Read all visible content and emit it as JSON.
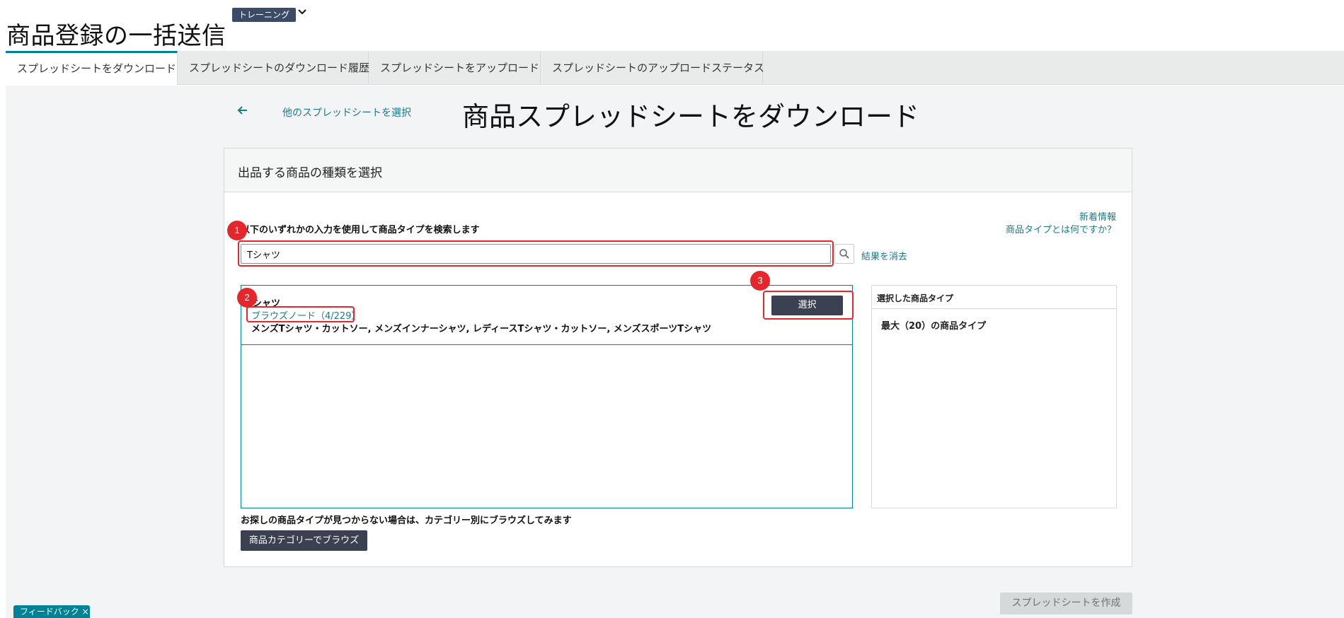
{
  "header": {
    "badge": "トレーニング",
    "title": "商品登録の一括送信"
  },
  "tabs": [
    "スプレッドシートをダウンロード",
    "スプレッドシートのダウンロード履歴",
    "スプレッドシートをアップロード",
    "スプレッドシートのアップロードステータス"
  ],
  "nav": {
    "back_link": "他のスプレッドシートを選択",
    "heading": "商品スプレッドシートをダウンロード"
  },
  "panel": {
    "header": "出品する商品の種類を選択",
    "links": {
      "new_info": "新着情報",
      "what_is_type": "商品タイプとは何ですか？"
    },
    "search": {
      "label": "以下のいずれかの入力を使用して商品タイプを検索します",
      "value": "Tシャツ",
      "clear": "結果を消去"
    },
    "result": {
      "name": "シャツ",
      "browse_node": "ブラウズノード（4/229）",
      "description": "メンズTシャツ・カットソー, メンズインナーシャツ, レディースTシャツ・カットソー, メンズスポーツTシャツ",
      "select_button": "選択"
    },
    "selected": {
      "header": "選択した商品タイプ",
      "max": "最大（20）の商品タイプ"
    },
    "not_found": "お探しの商品タイプが見つからない場合は、カテゴリー別にブラウズしてみます",
    "browse_button": "商品カテゴリーでブラウズ"
  },
  "footer": {
    "create_button": "スプレッドシートを作成",
    "feedback": "フィードバック ×"
  },
  "annotations": [
    "1",
    "2",
    "3"
  ],
  "colors": {
    "accent": "#008296",
    "link": "#1a7a8a",
    "dark_button": "#3b4150",
    "annotation": "#e5262a"
  }
}
